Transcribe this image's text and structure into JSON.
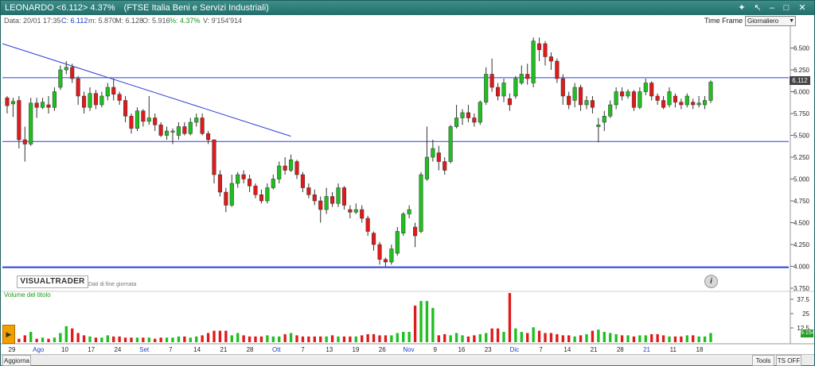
{
  "title_bar": {
    "symbol": "LEONARDO <6.112> 4.37%",
    "name": "(FTSE Italia Beni e Servizi Industriali)"
  },
  "info_bar": {
    "date": "Data: 20/01 17:35",
    "close": "C: 6.112",
    "min": "m: 5.870",
    "max": "M: 6.128",
    "open": "O: 5.916",
    "pct": "%: 4.37%",
    "volume": "V: 9'154'914"
  },
  "timeframe": {
    "label": "Time Frame",
    "value": "Giornaliero"
  },
  "logo": {
    "text": "VISUALTRADER",
    "subtitle": "Dati di fine giornata"
  },
  "volume_panel": {
    "title": "Volume del titolo"
  },
  "price_tag": "6.112",
  "vol_tag": "9.154M",
  "status_bar": {
    "refresh": "Aggiorna",
    "tools": "Tools",
    "ts": "TS OFF"
  },
  "colors": {
    "up": "#1fbf1f",
    "down": "#e01a1a",
    "trend": "#2d3fd6",
    "frame": "#2e7d7a"
  },
  "chart_data": {
    "type": "candlestick",
    "price_axis": {
      "range": [
        3.75,
        6.75
      ],
      "ticks": [
        "3.750",
        "4.000",
        "4.250",
        "4.500",
        "4.750",
        "5.000",
        "5.250",
        "5.500",
        "5.750",
        "6.000",
        "6.250",
        "6.500"
      ]
    },
    "volume_axis": {
      "unit": "M",
      "ticks": [
        "12.5",
        "25",
        "37.5"
      ],
      "range": [
        0,
        37.5
      ]
    },
    "x_labels": [
      {
        "label": "29",
        "blue": false
      },
      {
        "label": "Ago",
        "blue": true
      },
      {
        "label": "10",
        "blue": false
      },
      {
        "label": "17",
        "blue": false
      },
      {
        "label": "24",
        "blue": false
      },
      {
        "label": "Set",
        "blue": true
      },
      {
        "label": "7",
        "blue": false
      },
      {
        "label": "14",
        "blue": false
      },
      {
        "label": "21",
        "blue": false
      },
      {
        "label": "28",
        "blue": false
      },
      {
        "label": "Ott",
        "blue": true
      },
      {
        "label": "7",
        "blue": false
      },
      {
        "label": "13",
        "blue": false
      },
      {
        "label": "19",
        "blue": false
      },
      {
        "label": "26",
        "blue": false
      },
      {
        "label": "Nov",
        "blue": true
      },
      {
        "label": "9",
        "blue": false
      },
      {
        "label": "16",
        "blue": false
      },
      {
        "label": "23",
        "blue": false
      },
      {
        "label": "Dic",
        "blue": true
      },
      {
        "label": "7",
        "blue": false
      },
      {
        "label": "14",
        "blue": false
      },
      {
        "label": "21",
        "blue": false
      },
      {
        "label": "28",
        "blue": false
      },
      {
        "label": "21",
        "blue": true
      },
      {
        "label": "11",
        "blue": false
      },
      {
        "label": "18",
        "blue": false
      }
    ],
    "horizontal_lines": [
      6.16,
      5.43,
      3.99
    ],
    "trendline": {
      "from": {
        "bar": 0,
        "price": 6.55
      },
      "to": {
        "bar": 48,
        "price": 5.49
      }
    },
    "candles": [
      [
        5.93,
        5.84,
        5.95,
        5.75
      ],
      [
        5.86,
        5.89,
        5.93,
        5.71
      ],
      [
        5.9,
        5.45,
        5.95,
        5.35
      ],
      [
        5.45,
        5.4,
        5.6,
        5.2
      ],
      [
        5.4,
        5.87,
        5.93,
        5.38
      ],
      [
        5.87,
        5.82,
        5.93,
        5.7
      ],
      [
        5.82,
        5.88,
        5.93,
        5.8
      ],
      [
        5.85,
        5.82,
        5.95,
        5.75
      ],
      [
        5.82,
        6.0,
        6.05,
        5.78
      ],
      [
        6.05,
        6.25,
        6.3,
        6.02
      ],
      [
        6.25,
        6.28,
        6.35,
        6.2
      ],
      [
        6.28,
        6.15,
        6.32,
        6.1
      ],
      [
        6.15,
        5.95,
        6.18,
        5.85
      ],
      [
        5.95,
        5.82,
        6.0,
        5.75
      ],
      [
        5.82,
        5.98,
        6.05,
        5.78
      ],
      [
        5.98,
        5.85,
        6.02,
        5.8
      ],
      [
        5.85,
        5.95,
        6.0,
        5.82
      ],
      [
        5.95,
        6.05,
        6.1,
        5.9
      ],
      [
        6.05,
        5.97,
        6.15,
        5.9
      ],
      [
        5.97,
        5.9,
        6.0,
        5.85
      ],
      [
        5.9,
        5.72,
        5.95,
        5.65
      ],
      [
        5.72,
        5.58,
        5.75,
        5.52
      ],
      [
        5.58,
        5.78,
        5.82,
        5.55
      ],
      [
        5.78,
        5.66,
        5.8,
        5.6
      ],
      [
        5.66,
        5.7,
        5.95,
        5.62
      ],
      [
        5.7,
        5.62,
        5.75,
        5.55
      ],
      [
        5.62,
        5.5,
        5.65,
        5.48
      ],
      [
        5.5,
        5.55,
        5.6,
        5.45
      ],
      [
        5.55,
        5.55,
        5.58,
        5.4
      ],
      [
        5.5,
        5.6,
        5.65,
        5.45
      ],
      [
        5.6,
        5.52,
        5.65,
        5.5
      ],
      [
        5.52,
        5.65,
        5.7,
        5.5
      ],
      [
        5.65,
        5.7,
        5.75,
        5.6
      ],
      [
        5.7,
        5.52,
        5.75,
        5.5
      ],
      [
        5.52,
        5.45,
        5.55,
        5.4
      ],
      [
        5.45,
        5.05,
        5.45,
        4.95
      ],
      [
        5.05,
        4.85,
        5.1,
        4.8
      ],
      [
        4.85,
        4.7,
        4.9,
        4.62
      ],
      [
        4.7,
        4.95,
        5.05,
        4.68
      ],
      [
        4.95,
        5.05,
        5.08,
        4.9
      ],
      [
        5.05,
        5.0,
        5.1,
        4.95
      ],
      [
        5.0,
        4.92,
        5.05,
        4.85
      ],
      [
        4.92,
        4.82,
        4.95,
        4.78
      ],
      [
        4.82,
        4.75,
        4.88,
        4.72
      ],
      [
        4.75,
        4.9,
        4.95,
        4.72
      ],
      [
        4.9,
        5.0,
        5.05,
        4.88
      ],
      [
        5.0,
        5.15,
        5.2,
        4.95
      ],
      [
        5.15,
        5.1,
        5.25,
        5.05
      ],
      [
        5.1,
        5.22,
        5.28,
        5.08
      ],
      [
        5.2,
        5.05,
        5.22,
        5.0
      ],
      [
        5.05,
        4.9,
        5.08,
        4.85
      ],
      [
        4.9,
        4.82,
        4.95,
        4.78
      ],
      [
        4.82,
        4.75,
        4.88,
        4.7
      ],
      [
        4.75,
        4.65,
        4.8,
        4.5
      ],
      [
        4.65,
        4.8,
        4.9,
        4.6
      ],
      [
        4.8,
        4.72,
        4.85,
        4.68
      ],
      [
        4.72,
        4.9,
        4.95,
        4.68
      ],
      [
        4.9,
        4.7,
        4.92,
        4.65
      ],
      [
        4.65,
        4.62,
        4.7,
        4.55
      ],
      [
        4.62,
        4.65,
        4.72,
        4.6
      ],
      [
        4.65,
        4.55,
        4.7,
        4.5
      ],
      [
        4.55,
        4.4,
        4.58,
        4.35
      ],
      [
        4.38,
        4.25,
        4.4,
        4.18
      ],
      [
        4.25,
        4.08,
        4.28,
        4.02
      ],
      [
        4.08,
        4.05,
        4.1,
        4.0
      ],
      [
        4.05,
        4.2,
        4.25,
        4.02
      ],
      [
        4.15,
        4.4,
        4.45,
        4.12
      ],
      [
        4.38,
        4.6,
        4.62,
        4.35
      ],
      [
        4.6,
        4.65,
        4.7,
        4.55
      ],
      [
        4.45,
        4.35,
        4.5,
        4.22
      ],
      [
        4.4,
        5.05,
        5.08,
        4.38
      ],
      [
        5.0,
        5.25,
        5.6,
        4.98
      ],
      [
        5.25,
        5.35,
        5.45,
        5.2
      ],
      [
        5.3,
        5.2,
        5.38,
        5.1
      ],
      [
        5.2,
        5.1,
        5.25,
        5.05
      ],
      [
        5.2,
        5.6,
        5.62,
        5.18
      ],
      [
        5.6,
        5.7,
        5.85,
        5.58
      ],
      [
        5.7,
        5.76,
        5.8,
        5.62
      ],
      [
        5.76,
        5.7,
        5.85,
        5.65
      ],
      [
        5.7,
        5.65,
        5.75,
        5.6
      ],
      [
        5.65,
        5.88,
        5.9,
        5.62
      ],
      [
        5.88,
        6.2,
        6.28,
        5.85
      ],
      [
        6.2,
        6.05,
        6.38,
        6.0
      ],
      [
        6.05,
        5.95,
        6.1,
        5.9
      ],
      [
        5.95,
        6.1,
        6.15,
        5.88
      ],
      [
        5.92,
        5.85,
        5.98,
        5.78
      ],
      [
        5.95,
        6.15,
        6.18,
        5.92
      ],
      [
        6.1,
        6.2,
        6.3,
        6.08
      ],
      [
        6.2,
        6.15,
        6.32,
        6.08
      ],
      [
        6.1,
        6.58,
        6.62,
        6.05
      ],
      [
        6.55,
        6.48,
        6.62,
        6.35
      ],
      [
        6.55,
        6.4,
        6.58,
        6.3
      ],
      [
        6.4,
        6.35,
        6.45,
        6.25
      ],
      [
        6.35,
        6.15,
        6.38,
        6.1
      ],
      [
        6.15,
        5.95,
        6.2,
        5.85
      ],
      [
        5.95,
        5.85,
        6.0,
        5.8
      ],
      [
        5.9,
        6.05,
        6.1,
        5.82
      ],
      [
        6.05,
        5.85,
        6.08,
        5.78
      ],
      [
        5.85,
        5.9,
        5.95,
        5.8
      ],
      [
        5.9,
        5.82,
        5.95,
        5.75
      ],
      [
        5.6,
        5.62,
        5.7,
        5.42
      ],
      [
        5.65,
        5.72,
        5.78,
        5.55
      ],
      [
        5.72,
        5.85,
        5.9,
        5.7
      ],
      [
        5.85,
        6.0,
        6.05,
        5.8
      ],
      [
        6.0,
        5.95,
        6.05,
        5.9
      ],
      [
        5.95,
        6.0,
        6.03,
        5.92
      ],
      [
        6.0,
        5.82,
        6.02,
        5.78
      ],
      [
        5.82,
        6.0,
        6.05,
        5.8
      ],
      [
        6.0,
        6.1,
        6.15,
        5.96
      ],
      [
        6.1,
        5.95,
        6.12,
        5.9
      ],
      [
        5.95,
        5.9,
        5.98,
        5.85
      ],
      [
        5.9,
        5.82,
        5.95,
        5.8
      ],
      [
        5.85,
        6.0,
        6.05,
        5.82
      ],
      [
        5.95,
        5.88,
        5.98,
        5.82
      ],
      [
        5.88,
        5.85,
        5.92,
        5.8
      ],
      [
        5.85,
        5.95,
        5.98,
        5.82
      ],
      [
        5.88,
        5.85,
        5.92,
        5.8
      ],
      [
        5.85,
        5.87,
        5.95,
        5.82
      ],
      [
        5.85,
        5.9,
        5.95,
        5.8
      ],
      [
        5.9,
        6.11,
        6.13,
        5.87
      ]
    ],
    "volumes": [
      4,
      3,
      3,
      6,
      9,
      3,
      4,
      3,
      4,
      8,
      14,
      12,
      8,
      6,
      5,
      4,
      4,
      6,
      5,
      5,
      4,
      4,
      4,
      4,
      4,
      3,
      4,
      4,
      4,
      5,
      5,
      4,
      5,
      6,
      8,
      10,
      10,
      10,
      6,
      8,
      6,
      5,
      5,
      5,
      6,
      5,
      5,
      7,
      8,
      6,
      5,
      5,
      5,
      5,
      5,
      6,
      5,
      5,
      5,
      5,
      6,
      7,
      7,
      6,
      6,
      6,
      8,
      9,
      9,
      32,
      36,
      36,
      30,
      6,
      7,
      6,
      8,
      6,
      5,
      6,
      7,
      8,
      12,
      12,
      9,
      43,
      12,
      9,
      8,
      13,
      10,
      8,
      8,
      7,
      6,
      6,
      5,
      6,
      7,
      10,
      11,
      9,
      8,
      7,
      6,
      6,
      5,
      6,
      6,
      7,
      7,
      6,
      5,
      5,
      5,
      6,
      6,
      5,
      5,
      8,
      9,
      8,
      9
    ]
  }
}
